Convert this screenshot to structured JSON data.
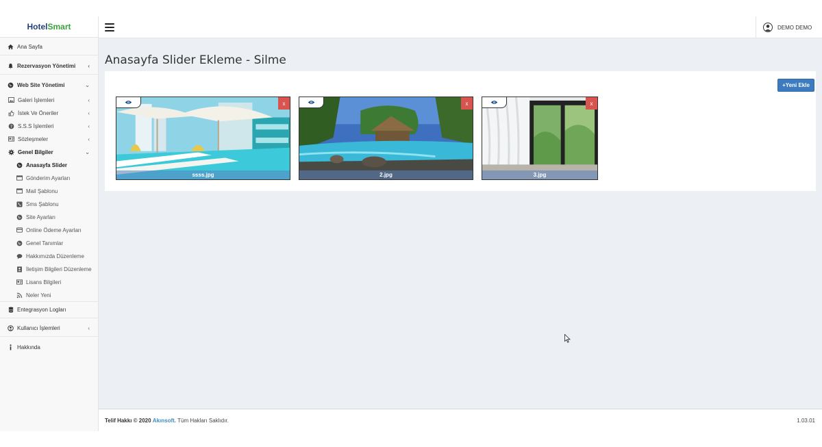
{
  "brand": {
    "part1": "Hotel",
    "part2": "Smart"
  },
  "sidebar": {
    "items": [
      {
        "label": "Ana Sayfa",
        "icon": "home-icon"
      },
      {
        "label": "Rezervasyon Yönetimi",
        "icon": "bell-icon"
      },
      {
        "label": "Web Site Yönetimi",
        "icon": "globe-icon"
      },
      {
        "label": "Galeri İşlemleri",
        "icon": "image-icon"
      },
      {
        "label": "İstek Ve Öneriler",
        "icon": "thumbs-up-icon"
      },
      {
        "label": "S.S.S İşlemleri",
        "icon": "question-icon"
      },
      {
        "label": "Sözleşmeler",
        "icon": "id-card-icon"
      },
      {
        "label": "Genel Bilgiler",
        "icon": "gear-icon"
      },
      {
        "label": "Anasayfa Slider",
        "icon": "globe-icon"
      },
      {
        "label": "Gönderim Ayarları",
        "icon": "window-icon"
      },
      {
        "label": "Mail Şablonu",
        "icon": "window-icon"
      },
      {
        "label": "Sms Şablonu",
        "icon": "phone-square-icon"
      },
      {
        "label": "Site Ayarları",
        "icon": "globe-icon"
      },
      {
        "label": "Online Ödeme Ayarları",
        "icon": "credit-card-icon"
      },
      {
        "label": "Genel Tanımlar",
        "icon": "globe-icon"
      },
      {
        "label": "Hakkımızda Düzenleme",
        "icon": "comment-icon"
      },
      {
        "label": "İletişim Bilgileri Düzenleme",
        "icon": "contact-book-icon"
      },
      {
        "label": "Lisans Bilgileri",
        "icon": "id-card-icon"
      },
      {
        "label": "Neler Yeni",
        "icon": "rss-icon"
      },
      {
        "label": "Entegrasyon Logları",
        "icon": "database-icon"
      },
      {
        "label": "Kullanıcı İşlemleri",
        "icon": "user-circle-icon"
      },
      {
        "label": "Hakkında",
        "icon": "info-icon"
      }
    ]
  },
  "header": {
    "user_name": "DEMO DEMO"
  },
  "main": {
    "title": "Anasayfa Slider Ekleme - Silme",
    "new_button": "+Yeni Ekle",
    "delete_label": "x",
    "images": [
      {
        "filename": "ssss.jpg"
      },
      {
        "filename": "2.jpg"
      },
      {
        "filename": "3.jpg"
      }
    ]
  },
  "footer": {
    "copyright": "Telif Hakkı © 2020",
    "company": "Akınsoft.",
    "rights": " Tüm Hakları Saklıdır.",
    "version": "1.03.01"
  },
  "colors": {
    "accent": "#3c7bc0",
    "danger": "#d9534f",
    "brand_blue": "#1f3f7a",
    "brand_green": "#3aa13c"
  }
}
